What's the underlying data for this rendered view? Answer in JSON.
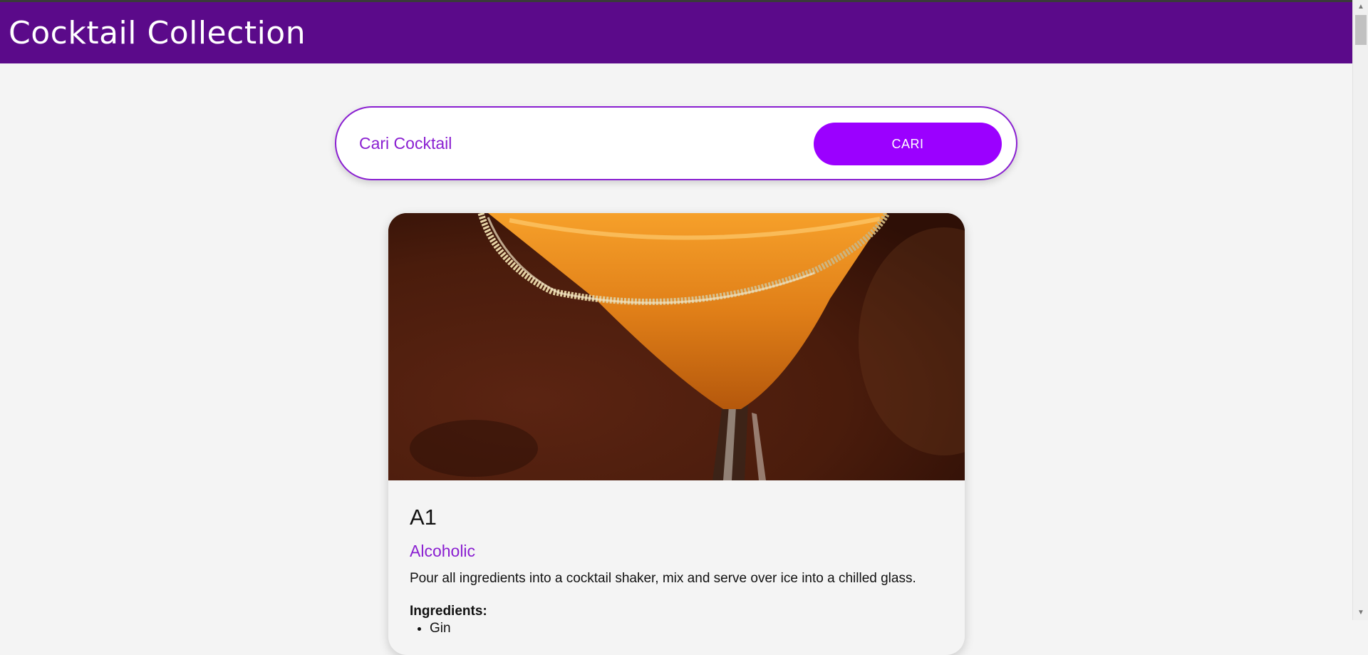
{
  "header": {
    "title": "Cocktail Collection"
  },
  "search": {
    "placeholder": "Cari Cocktail",
    "value": "",
    "button_label": "CARI"
  },
  "card": {
    "image_alt": "cocktail-image",
    "name": "A1",
    "category": "Alcoholic",
    "instructions": "Pour all ingredients into a cocktail shaker, mix and serve over ice into a chilled glass.",
    "ingredients_heading": "Ingredients:",
    "ingredients": [
      "Gin"
    ]
  },
  "colors": {
    "header_bg": "#5b0a8a",
    "accent": "#9b00ff",
    "accent_text": "#8a1fd1",
    "page_bg": "#f4f4f4"
  }
}
